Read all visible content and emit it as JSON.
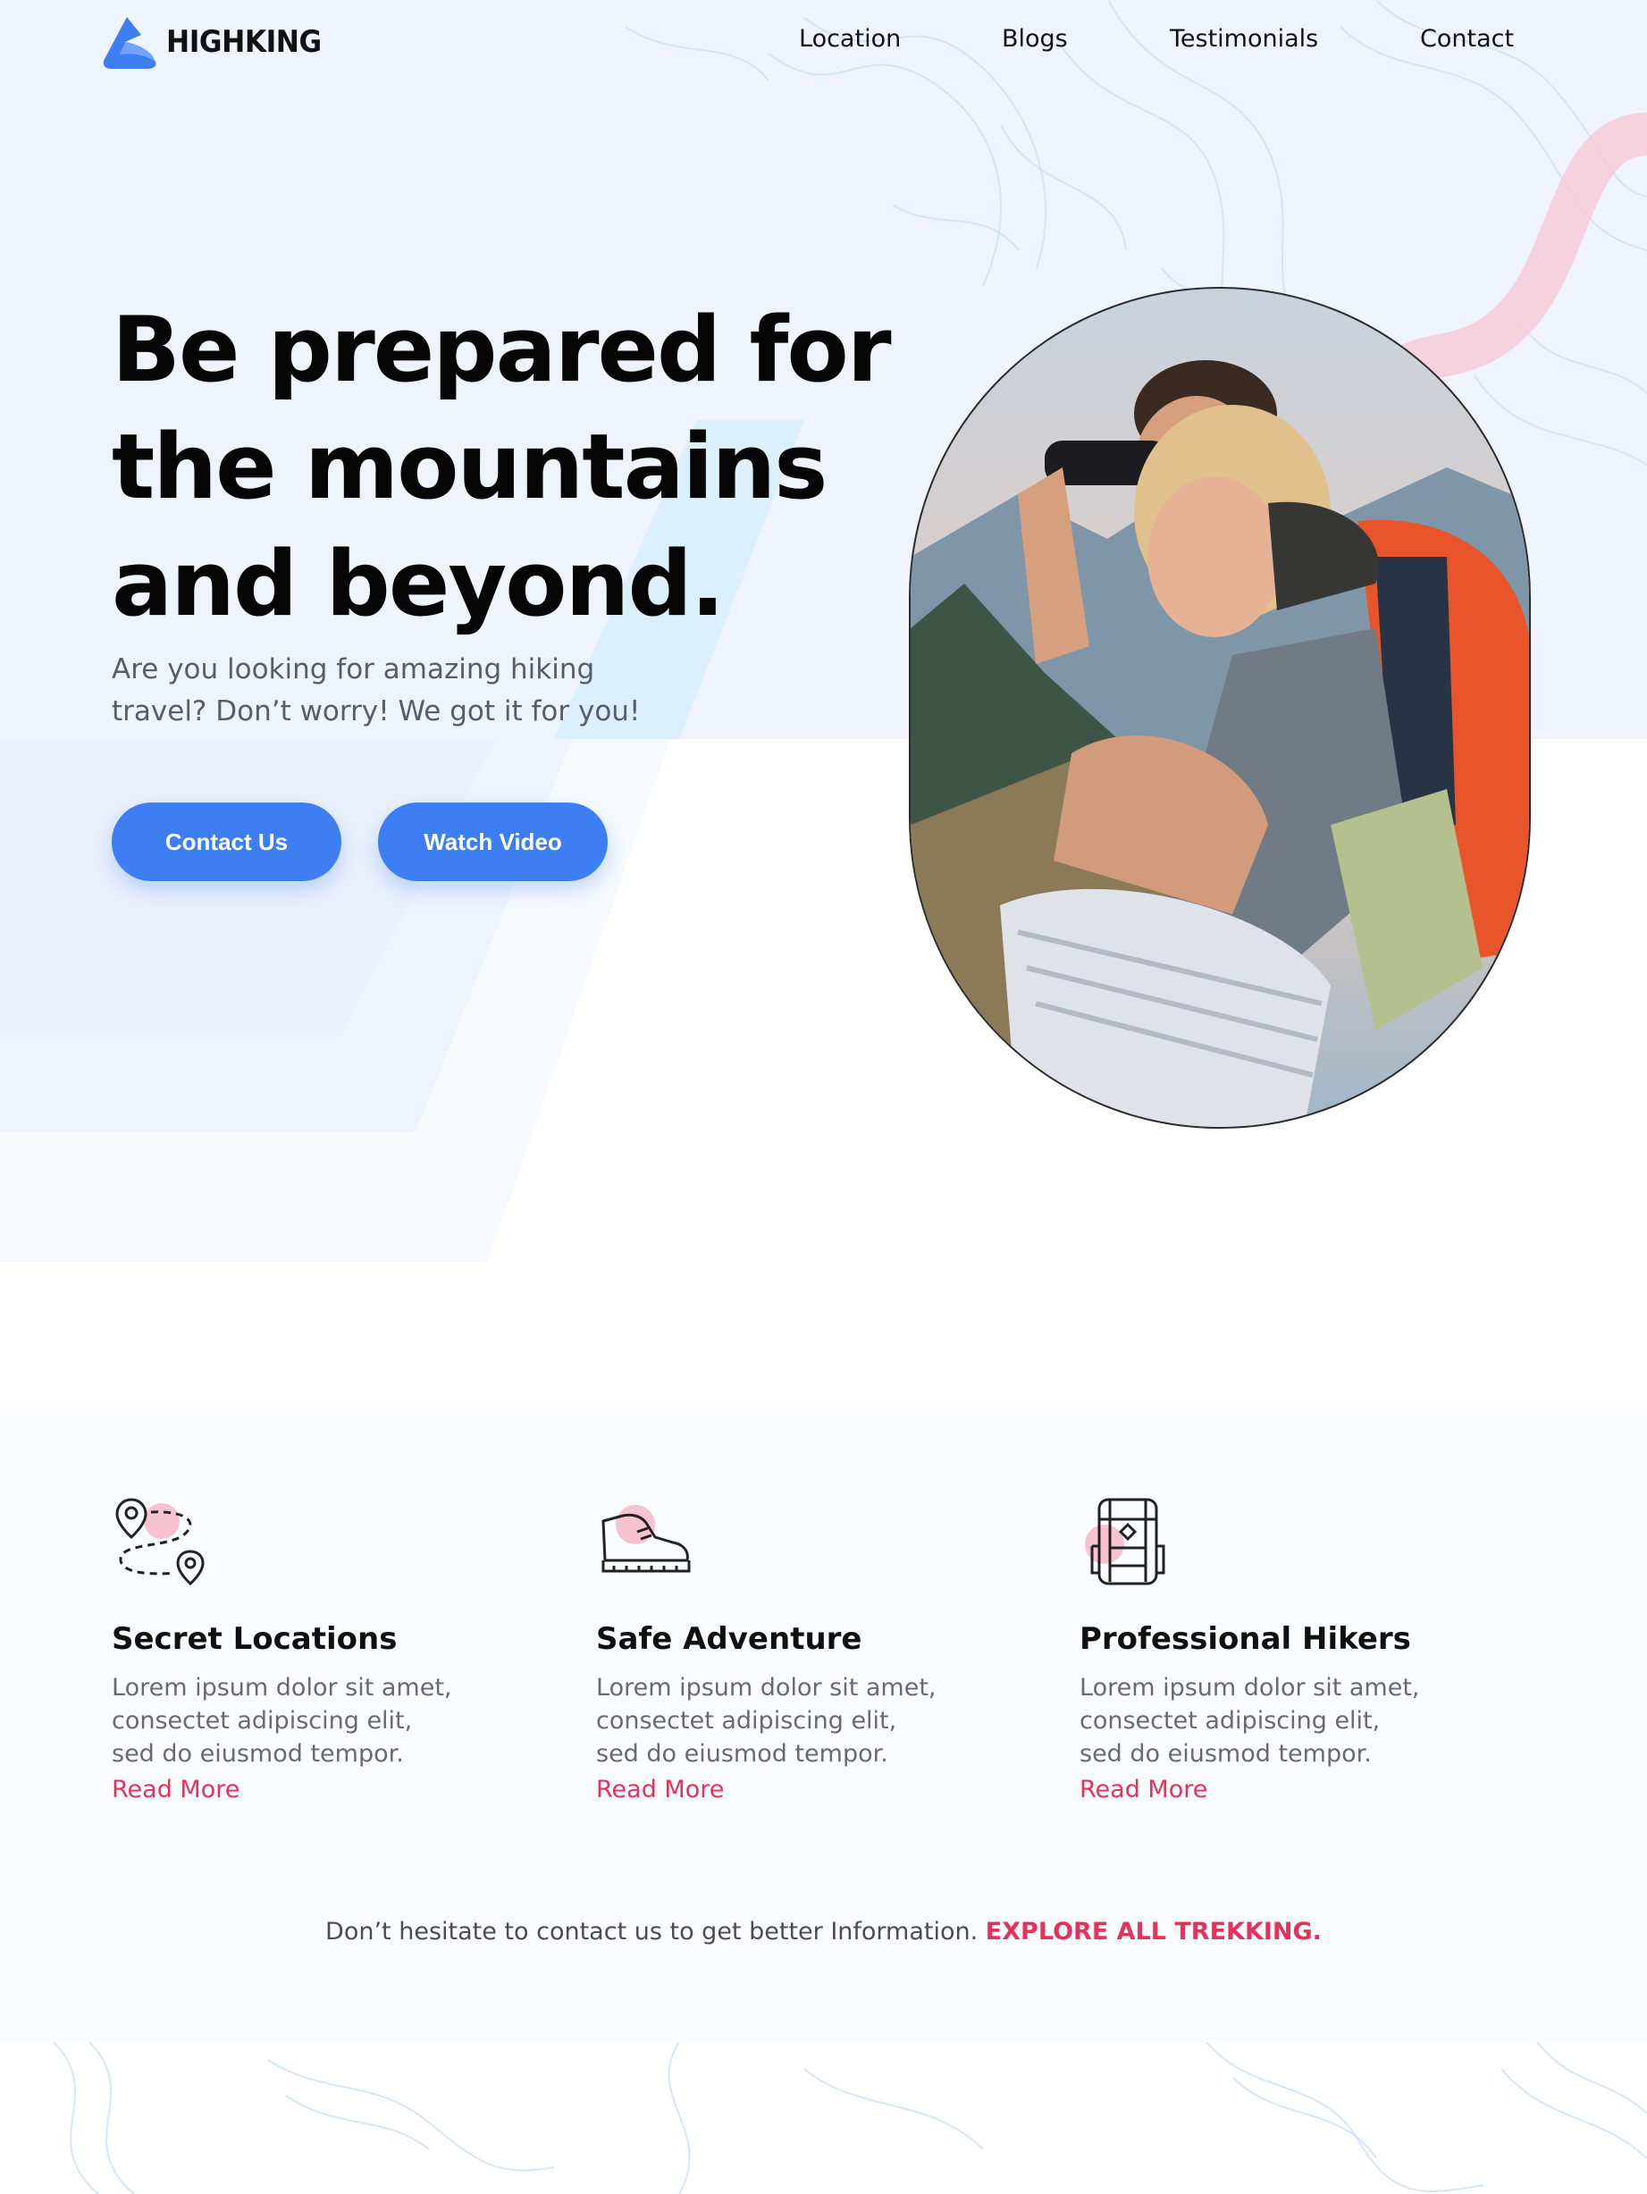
{
  "brand": {
    "name": "HIGHKING",
    "logo_icon": "mountain-logo-icon",
    "primary": "#3d7ef3",
    "accent": "#e6315b"
  },
  "nav": {
    "items": [
      {
        "label": "Location"
      },
      {
        "label": "Blogs"
      },
      {
        "label": "Testimonials"
      },
      {
        "label": "Contact"
      }
    ]
  },
  "hero": {
    "title_lines": [
      "Be prepared for",
      "the mountains",
      "and beyond."
    ],
    "subtitle": "Are you looking for amazing hiking travel? Don’t worry! We got it for you!",
    "contact_button": "Contact Us",
    "video_button": "Watch Video",
    "photo_icon": "hikers-photo"
  },
  "features": [
    {
      "icon": "map-route-icon",
      "title": "Secret Locations",
      "description": "Lorem ipsum dolor sit amet, consectet adipiscing elit, sed do eiusmod tempor.",
      "link": "Read More"
    },
    {
      "icon": "hiking-boot-icon",
      "title": "Safe Adventure",
      "description": "Lorem ipsum dolor sit amet, consectet adipiscing elit, sed do eiusmod tempor.",
      "link": "Read More"
    },
    {
      "icon": "backpack-icon",
      "title": "Professional Hikers",
      "description": "Lorem ipsum dolor sit amet, consectet adipiscing elit, sed do eiusmod tempor.",
      "link": "Read More"
    }
  ],
  "cta": {
    "text": "Don’t hesitate to contact us to get better Information.",
    "link": "EXPLORE ALL TREKKING."
  }
}
